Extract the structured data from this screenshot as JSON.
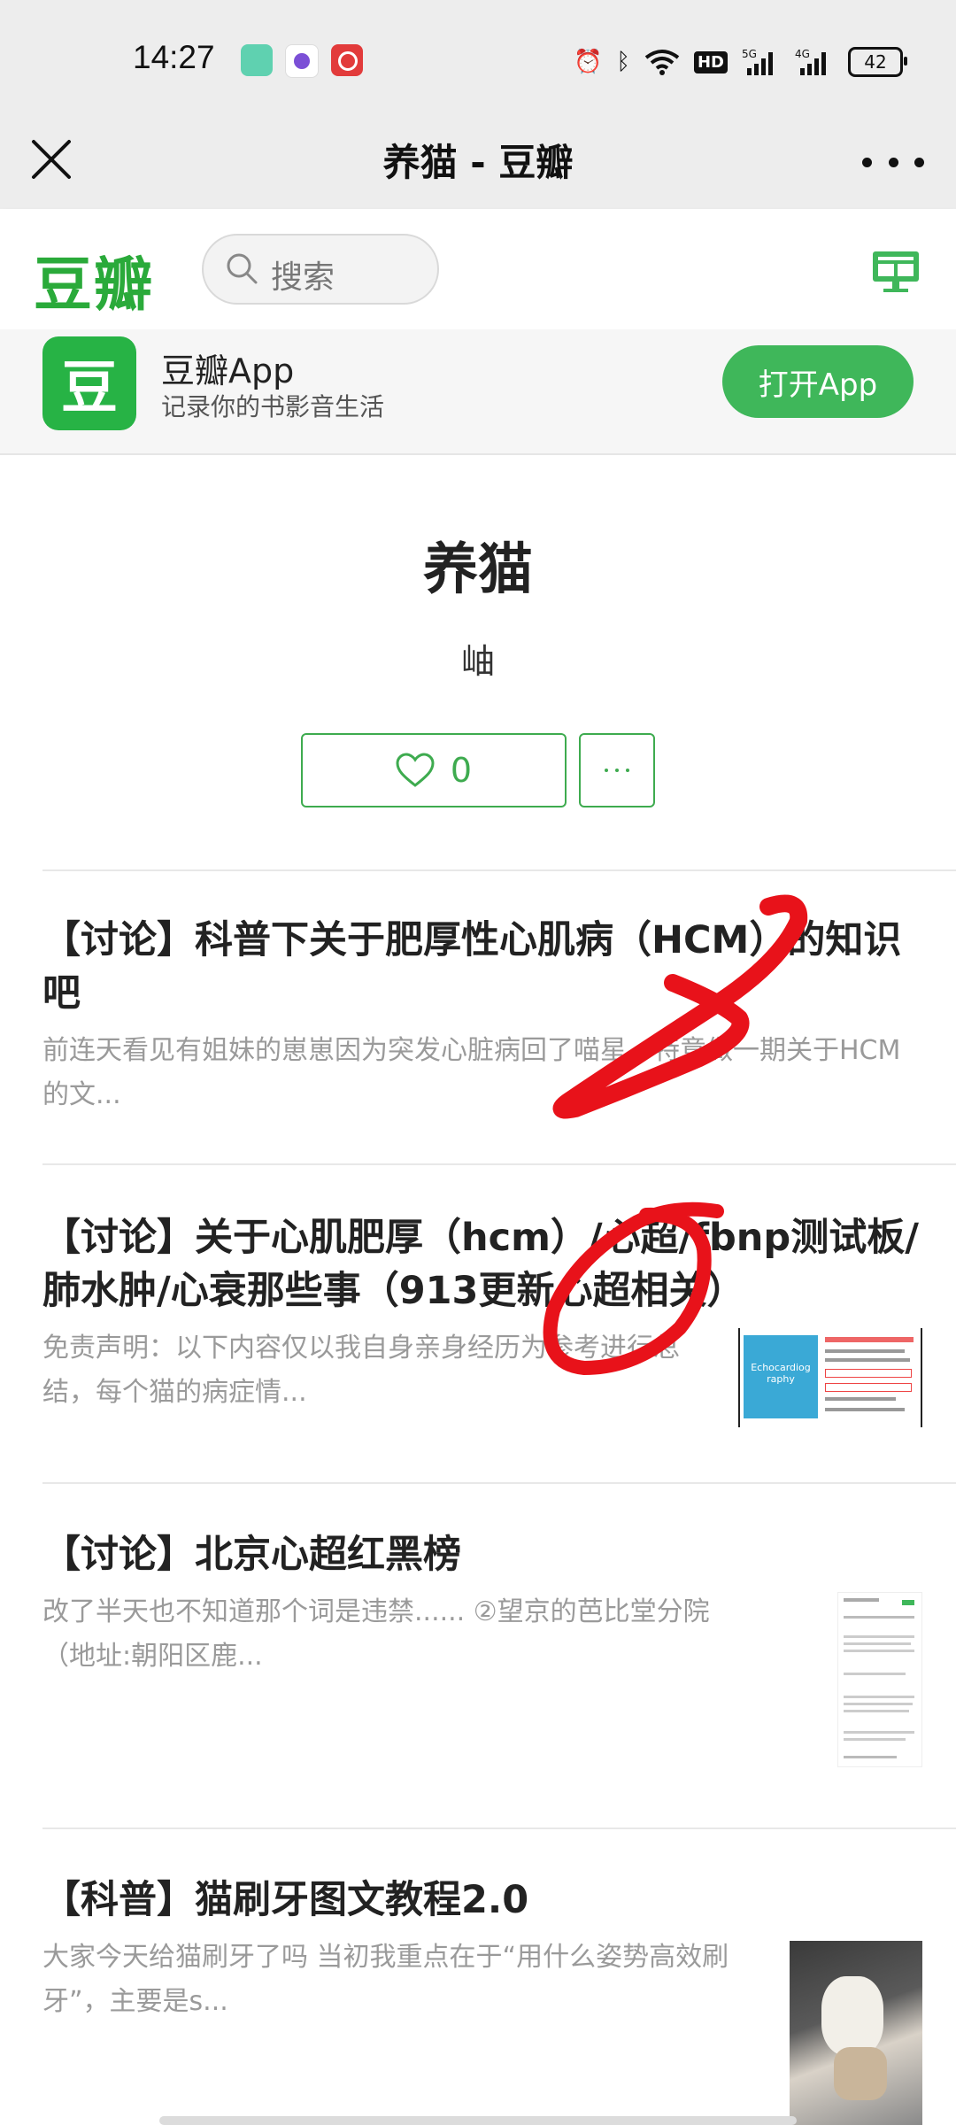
{
  "status_bar": {
    "time": "14:27",
    "battery": "42",
    "icons": [
      "alarm-icon",
      "bluetooth-icon",
      "wifi-icon",
      "hd-icon",
      "signal-5g-icon",
      "signal-4g-icon",
      "battery-icon"
    ]
  },
  "navbar": {
    "title": "养猫 - 豆瓣"
  },
  "header": {
    "logo": "豆瓣",
    "search_placeholder": "搜索"
  },
  "app_banner": {
    "icon_char": "豆",
    "name": "豆瓣App",
    "subtitle": "记录你的书影音生活",
    "open_button": "打开App"
  },
  "topic": {
    "title": "养猫",
    "author": "岫",
    "like_count": "0"
  },
  "posts": [
    {
      "title": "【讨论】科普下关于肥厚性心肌病（HCM）的知识吧",
      "excerpt": "前连天看见有姐妹的崽崽因为突发心脏病回了喵星，特意做一期关于HCM的文..."
    },
    {
      "title": "【讨论】关于心肌肥厚（hcm）/心超/fbnp测试板/肺水肿/心衰那些事（913更新心超相关）",
      "excerpt": "免责声明：以下内容仅以我自身亲身经历为参考进行总结，每个猫的病症情...",
      "thumb_text": "Echocardiog raphy"
    },
    {
      "title": "【讨论】北京心超红黑榜",
      "excerpt": "改了半天也不知道那个词是违禁...... ②望京的芭比堂分院（地址:朝阳区鹿..."
    },
    {
      "title": "【科普】猫刷牙图文教程2.0",
      "excerpt": "大家今天给猫刷牙了吗 当初我重点在于“用什么姿势高效刷牙”，主要是s..."
    }
  ],
  "colors": {
    "douban_green": "#2aaa3a",
    "button_green": "#3fb75a",
    "annotation_red": "#e8121a"
  }
}
